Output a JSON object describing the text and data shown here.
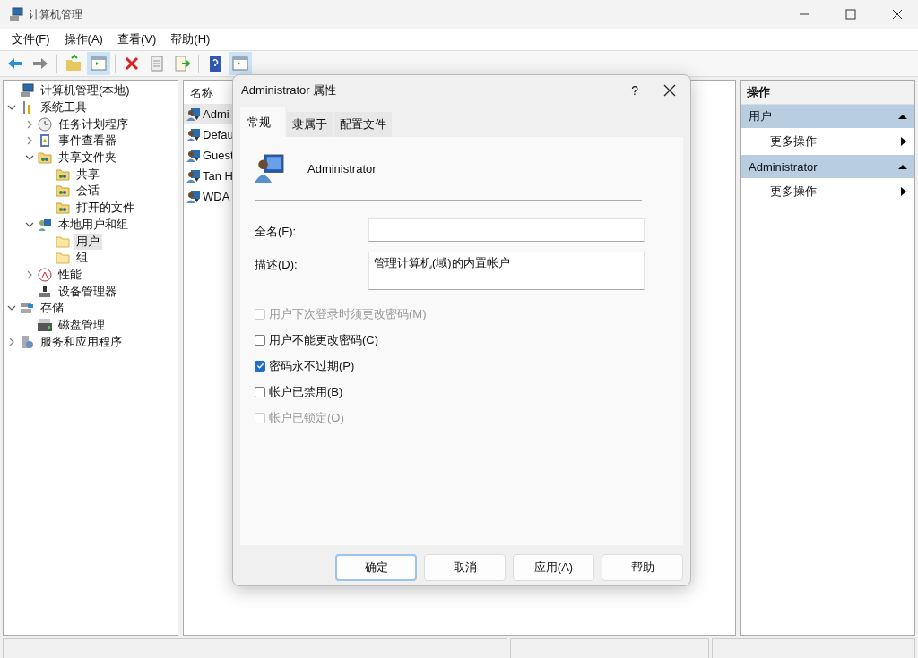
{
  "window": {
    "title": "计算机管理"
  },
  "menu": [
    "文件(F)",
    "操作(A)",
    "查看(V)",
    "帮助(H)"
  ],
  "toolbar": [
    {
      "kind": "back",
      "on": false
    },
    {
      "kind": "forward",
      "on": false
    },
    {
      "kind": "separator"
    },
    {
      "kind": "up",
      "on": false
    },
    {
      "kind": "tree-toggle",
      "on": true
    },
    {
      "kind": "separator"
    },
    {
      "kind": "delete",
      "on": false
    },
    {
      "kind": "properties",
      "on": false
    },
    {
      "kind": "export",
      "on": false
    },
    {
      "kind": "separator"
    },
    {
      "kind": "help",
      "on": false
    },
    {
      "kind": "action-toggle",
      "on": true
    }
  ],
  "tree": [
    {
      "label": "计算机管理(本地)",
      "kind": "computer",
      "selected": false,
      "children": [
        {
          "label": "系统工具",
          "kind": "tools",
          "selected": false,
          "expanded": true,
          "children": [
            {
              "label": "任务计划程序",
              "kind": "clock",
              "selected": false,
              "expanded": false
            },
            {
              "label": "事件查看器",
              "kind": "log",
              "selected": false,
              "expanded": false
            },
            {
              "label": "共享文件夹",
              "kind": "share",
              "selected": false,
              "expanded": true,
              "children": [
                {
                  "label": "共享",
                  "kind": "share",
                  "selected": false
                },
                {
                  "label": "会话",
                  "kind": "share",
                  "selected": false
                },
                {
                  "label": "打开的文件",
                  "kind": "share",
                  "selected": false
                }
              ]
            },
            {
              "label": "本地用户和组",
              "kind": "users",
              "selected": false,
              "expanded": true,
              "children": [
                {
                  "label": "用户",
                  "kind": "folder",
                  "selected": true
                },
                {
                  "label": "组",
                  "kind": "folder",
                  "selected": false
                }
              ]
            },
            {
              "label": "性能",
              "kind": "gauge",
              "selected": false,
              "expanded": false
            },
            {
              "label": "设备管理器",
              "kind": "device",
              "selected": false
            }
          ]
        },
        {
          "label": "存储",
          "kind": "storage",
          "selected": false,
          "expanded": true,
          "children": [
            {
              "label": "磁盘管理",
              "kind": "disk",
              "selected": false
            }
          ]
        },
        {
          "label": "服务和应用程序",
          "kind": "services",
          "selected": false,
          "expanded": false
        }
      ]
    }
  ],
  "list": {
    "column": "名称",
    "rows": [
      {
        "name": "Admi",
        "selected": true
      },
      {
        "name": "Defau",
        "selected": false
      },
      {
        "name": "Guest",
        "selected": false
      },
      {
        "name": "Tan H",
        "selected": false
      },
      {
        "name": "WDA",
        "selected": false
      }
    ]
  },
  "dialog": {
    "title": "Administrator 属性",
    "help": "?",
    "tabs": [
      {
        "label": "常规",
        "selected": true
      },
      {
        "label": "隶属于",
        "selected": false
      },
      {
        "label": "配置文件",
        "selected": false
      }
    ],
    "user_name": "Administrator",
    "fields": [
      {
        "label": "全名(F):",
        "kind": "line"
      },
      {
        "label": "描述(D):",
        "value": "管理计算机(域)的内置帐户",
        "kind": "area"
      }
    ],
    "checkboxes": [
      {
        "label": "用户下次登录时须更改密码(M)",
        "checked": false,
        "disabled": true
      },
      {
        "label": "用户不能更改密码(C)",
        "checked": false,
        "disabled": false
      },
      {
        "label": "密码永不过期(P)",
        "checked": true,
        "disabled": false
      },
      {
        "label": "帐户已禁用(B)",
        "checked": false,
        "disabled": false
      },
      {
        "label": "帐户已锁定(O)",
        "checked": false,
        "disabled": true
      }
    ],
    "buttons": [
      {
        "label": "确定",
        "default": true
      },
      {
        "label": "取消",
        "default": false
      },
      {
        "label": "应用(A)",
        "default": false
      },
      {
        "label": "帮助",
        "default": false
      }
    ]
  },
  "actions": {
    "title": "操作",
    "sections": [
      {
        "title": "用户",
        "expanded": true,
        "items": [
          "更多操作"
        ]
      },
      {
        "title": "Administrator",
        "expanded": true,
        "items": [
          "更多操作"
        ]
      }
    ]
  }
}
